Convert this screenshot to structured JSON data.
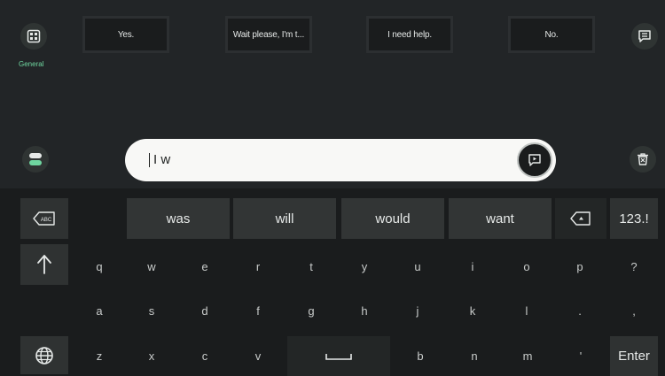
{
  "category": {
    "label": "General"
  },
  "phrases": [
    "Yes.",
    "Wait please, I'm t...",
    "I need help.",
    "No."
  ],
  "input": {
    "text": "I w"
  },
  "suggestions": [
    "was",
    "will",
    "would",
    "want"
  ],
  "keys": {
    "row1": [
      "q",
      "w",
      "e",
      "r",
      "t",
      "y",
      "u",
      "i",
      "o",
      "p",
      "?"
    ],
    "row2": [
      "a",
      "s",
      "d",
      "f",
      "g",
      "h",
      "j",
      "k",
      "l",
      ".",
      ","
    ],
    "row3": [
      "z",
      "x",
      "c",
      "v",
      "b",
      "n",
      "m",
      "'"
    ],
    "numbers": "123.!",
    "enter": "Enter"
  },
  "colors": {
    "accent": "#6fd6a0",
    "input_bg": "#f8f8f6",
    "background": "#1a1c1d"
  }
}
